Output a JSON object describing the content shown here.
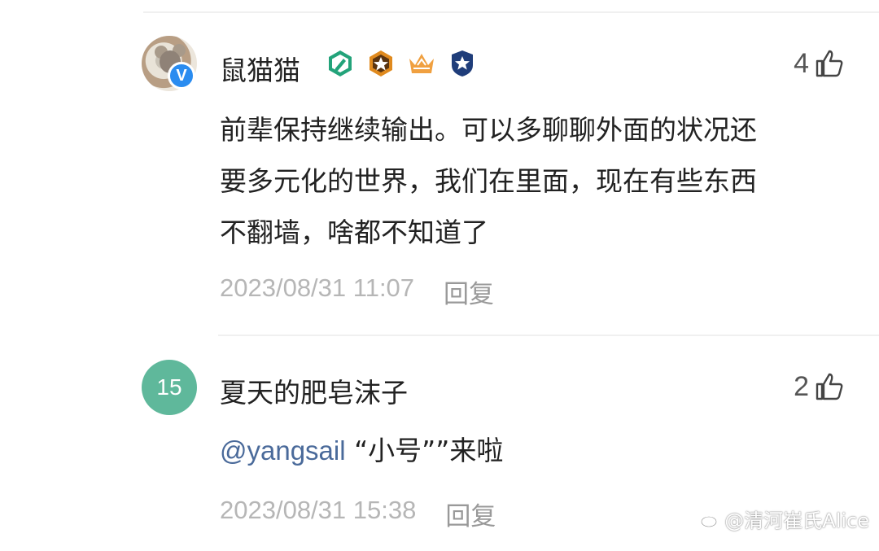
{
  "comments": [
    {
      "username": "鼠猫猫",
      "likes": "4",
      "content_lines": [
        "前辈保持继续输出。可以多聊聊外面的状况还",
        "要多元化的世界，我们在里面，现在有些东西",
        "不翻墙，啥都不知道了"
      ],
      "timestamp": "2023/08/31 11:07",
      "reply_label": "回复",
      "verified_badge": "V",
      "badges": [
        "pen-badge",
        "star-badge",
        "crown-badge",
        "shield-star-badge"
      ]
    },
    {
      "username": "夏天的肥皂沫子",
      "avatar_text": "15",
      "likes": "2",
      "mention": "@yangsail",
      "content_rest": " “小号””来啦",
      "timestamp": "2023/08/31 15:38",
      "reply_label": "回复"
    }
  ],
  "watermark": "@清河崔氏Alice",
  "colors": {
    "accent_blue": "#2a8cf0",
    "mention": "#4a6a9a",
    "avatar_green": "#5fb89b",
    "meta_gray": "#b6b6b6"
  },
  "icons": {
    "like": "thumbs-up-icon",
    "watermark_logo": "weibo-logo-icon"
  }
}
